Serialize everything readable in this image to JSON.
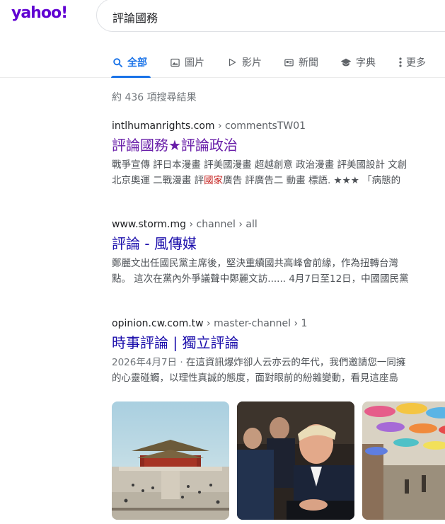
{
  "logo": "yahoo!",
  "search": {
    "query": "評論國務"
  },
  "tabs": [
    {
      "label": "全部",
      "icon": "search-icon"
    },
    {
      "label": "圖片",
      "icon": "image-icon"
    },
    {
      "label": "影片",
      "icon": "play-icon"
    },
    {
      "label": "新聞",
      "icon": "news-icon"
    },
    {
      "label": "字典",
      "icon": "mortarboard-icon"
    },
    {
      "label": "更多",
      "icon": "more-vert-icon"
    }
  ],
  "stats": "約 436 項搜尋結果",
  "results": [
    {
      "domain": "intlhumanrights.com",
      "path": " › commentsTW01",
      "title": "評論國務★評論政治",
      "snippet1": "戰爭宣傳 評日本漫畫 評美國漫畫 超越創意 政治漫畫 評美國設計 文創",
      "snippet2a": "北京奧運 二戰漫畫 評",
      "snippet2hl": "國家",
      "snippet2b": "廣告 評廣告二 動畫 標語. ★★★ 「病態的"
    },
    {
      "domain": "www.storm.mg",
      "path": " › channel › all",
      "title": "評論 - 風傳媒",
      "snippet1": "鄭麗文出任國民黨主席後，堅決重續國共高峰會前緣，作為扭轉台灣",
      "snippet2": "點。 這次在黨內外爭議聲中鄭麗文訪...... 4月7日至12日，中國國民黨"
    },
    {
      "domain": "opinion.cw.com.tw",
      "path": " › master-channel › 1",
      "title": "時事評論 | 獨立評論",
      "date": "2026年4月7日 · ",
      "snippet1": "在這資訊爆炸卻人云亦云的年代，我們邀請您一同擁",
      "snippet2": "的心靈碰觸，以理性真誠的態度，面對眼前的紛雜變動，看見這座島"
    }
  ],
  "colors": {
    "logo": "#6001d2",
    "active_tab": "#1a73e8",
    "visited_link": "#681da8",
    "link": "#1a0dab",
    "highlight": "#c5221f"
  }
}
